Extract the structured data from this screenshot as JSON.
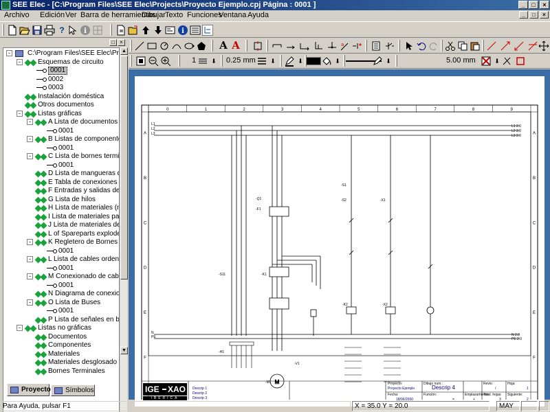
{
  "window": {
    "title": "SEE Elec - [C:\\Program Files\\SEE Elec\\Projects\\Proyecto Ejemplo.cpj      Página : 0001 ]",
    "minimize": "_",
    "maximize": "□",
    "close": "×"
  },
  "menu": {
    "items": [
      "Archivo",
      "Edición",
      "Ver",
      "Barra de herramientas",
      "Dibujar",
      "Texto",
      "Funciones",
      "Ventana",
      "Ayuda"
    ],
    "mdi_buttons": [
      "_",
      "□",
      "×"
    ]
  },
  "tree": {
    "header_buttons": [
      "□",
      "×"
    ],
    "items": [
      {
        "label": "C:\\Program Files\\SEE Elec\\Proje",
        "indent": 0,
        "icon": "project-icon",
        "expander": "-"
      },
      {
        "label": "Esquemas de circuito",
        "indent": 1,
        "icon": "folder-diamond-icon",
        "expander": "-"
      },
      {
        "label": "0001",
        "indent": 2,
        "icon": "schema-icon",
        "expander": "",
        "selected": true
      },
      {
        "label": "0002",
        "indent": 2,
        "icon": "schema-icon",
        "expander": ""
      },
      {
        "label": "0003",
        "indent": 2,
        "icon": "schema-icon",
        "expander": ""
      },
      {
        "label": "Instalación doméstica",
        "indent": 1,
        "icon": "folder-diamond-icon",
        "expander": ""
      },
      {
        "label": "Otros documentos",
        "indent": 1,
        "icon": "folder-diamond-icon",
        "expander": ""
      },
      {
        "label": "Listas gráficas",
        "indent": 1,
        "icon": "folder-diamond-icon",
        "expander": "-"
      },
      {
        "label": "A Lista de documentos",
        "indent": 2,
        "icon": "folder-diamond-icon",
        "expander": "-"
      },
      {
        "label": "0001",
        "indent": 3,
        "icon": "schema-icon",
        "expander": ""
      },
      {
        "label": "B Listas de componente",
        "indent": 2,
        "icon": "folder-diamond-icon",
        "expander": "-"
      },
      {
        "label": "0001",
        "indent": 3,
        "icon": "schema-icon",
        "expander": ""
      },
      {
        "label": "C Lista de bornes termin",
        "indent": 2,
        "icon": "folder-diamond-icon",
        "expander": "-"
      },
      {
        "label": "0001",
        "indent": 3,
        "icon": "schema-icon",
        "expander": ""
      },
      {
        "label": "D Lista de mangueras de",
        "indent": 2,
        "icon": "folder-diamond-icon",
        "expander": ""
      },
      {
        "label": "E Tabla de conexiones",
        "indent": 2,
        "icon": "folder-diamond-icon",
        "expander": ""
      },
      {
        "label": "F Entradas y salidas de F",
        "indent": 2,
        "icon": "folder-diamond-icon",
        "expander": ""
      },
      {
        "label": "G Lista de hilos",
        "indent": 2,
        "icon": "folder-diamond-icon",
        "expander": ""
      },
      {
        "label": "H Lista de materiales (nc",
        "indent": 2,
        "icon": "folder-diamond-icon",
        "expander": ""
      },
      {
        "label": "I Lista de materiales para",
        "indent": 2,
        "icon": "folder-diamond-icon",
        "expander": ""
      },
      {
        "label": "J Lista de materiales des",
        "indent": 2,
        "icon": "folder-diamond-icon",
        "expander": ""
      },
      {
        "label": "L of Spareparts exploded",
        "indent": 2,
        "icon": "folder-diamond-icon",
        "expander": ""
      },
      {
        "label": "K Regletero de Bornes",
        "indent": 2,
        "icon": "folder-diamond-icon",
        "expander": "-"
      },
      {
        "label": "0001",
        "indent": 3,
        "icon": "schema-icon",
        "expander": ""
      },
      {
        "label": "L Lista de cables ordena",
        "indent": 2,
        "icon": "folder-diamond-icon",
        "expander": "-"
      },
      {
        "label": "0001",
        "indent": 3,
        "icon": "schema-icon",
        "expander": ""
      },
      {
        "label": "M Conexionado de cable",
        "indent": 2,
        "icon": "folder-diamond-icon",
        "expander": "-"
      },
      {
        "label": "0001",
        "indent": 3,
        "icon": "schema-icon",
        "expander": ""
      },
      {
        "label": "N Diagrama de conexion",
        "indent": 2,
        "icon": "folder-diamond-icon",
        "expander": ""
      },
      {
        "label": "O Lista de Buses",
        "indent": 2,
        "icon": "folder-diamond-icon",
        "expander": "-"
      },
      {
        "label": "0001",
        "indent": 3,
        "icon": "schema-icon",
        "expander": ""
      },
      {
        "label": "P Lista de señales en bu",
        "indent": 2,
        "icon": "folder-diamond-icon",
        "expander": ""
      },
      {
        "label": "Listas no gráficas",
        "indent": 1,
        "icon": "folder-diamond-icon",
        "expander": "-"
      },
      {
        "label": "Documentos",
        "indent": 2,
        "icon": "folder-diamond-icon",
        "expander": ""
      },
      {
        "label": "Componentes",
        "indent": 2,
        "icon": "folder-diamond-icon",
        "expander": ""
      },
      {
        "label": "Materiales",
        "indent": 2,
        "icon": "folder-diamond-icon",
        "expander": ""
      },
      {
        "label": "Materiales desglosado",
        "indent": 2,
        "icon": "folder-diamond-icon",
        "expander": ""
      },
      {
        "label": "Bornes Terminales",
        "indent": 2,
        "icon": "folder-diamond-icon",
        "expander": ""
      }
    ]
  },
  "panel_tabs": [
    {
      "label": "Proyecto",
      "active": true
    },
    {
      "label": "Símbolos",
      "active": false
    }
  ],
  "draw_toolbar": {
    "text_buttons": [
      "A",
      "A"
    ],
    "line_width_value": "1",
    "text_size_value": "0.25 mm",
    "grid_value": "5.00 mm"
  },
  "sheet": {
    "columns": [
      "0",
      "1",
      "2",
      "3",
      "4",
      "5",
      "6",
      "7",
      "8",
      "9"
    ],
    "rows": [
      "A",
      "B",
      "C",
      "D",
      "E",
      "F"
    ],
    "bus_labels_left": [
      "L1",
      "L2",
      "L3",
      "N",
      "PE"
    ],
    "bus_labels_right": [
      "L1 2.0",
      "L2 2.0",
      "L3 2.0",
      "N 2.0",
      "PE 2.0"
    ],
    "device_labels": [
      "-Q1",
      "-F1",
      "-S11",
      "-K1",
      "-K2",
      "-X2",
      "-S1",
      "-S2",
      "-X1",
      "-H1",
      "-M1",
      "-V1"
    ],
    "titleblock": {
      "logo_left": "IGE",
      "logo_right": "XAO",
      "logo_sub": "IBERICA",
      "descrip": [
        "Descrip 1",
        "Descrip 2",
        "Descrip 3"
      ],
      "proyecto_label": "Proyecto:",
      "proyecto_value": "Proyecto Ejemplo",
      "fecha_label": "Fecha:",
      "fecha_value": "18/06/2000",
      "dibujo_label": "Dibujo num.:",
      "dibujo_value": "Descrip 4",
      "funcion_label": "Función:",
      "funcion_value": "=",
      "emplaz_label": "Emplazamiento:",
      "emplaz_value": "+",
      "revis_label": "Revis:",
      "revis_value": "/",
      "hoja_label": "Hoja:",
      "hoja_value": "1",
      "total_label": "Total. hojas:",
      "total_value": "3",
      "sig_label": "Siguiente:",
      "sig_value": "2"
    }
  },
  "status": {
    "help": "Para Ayuda, pulsar F1",
    "coords": "X = 35.0 Y = 20.0",
    "caps": "MAY"
  },
  "colors": {
    "titlebar_start": "#0a246a",
    "titlebar_end": "#3a6ea5",
    "canvas_bg": "#3a6ea5",
    "tree_icon_green": "#1aa33a",
    "tool_red": "#cc0000"
  }
}
